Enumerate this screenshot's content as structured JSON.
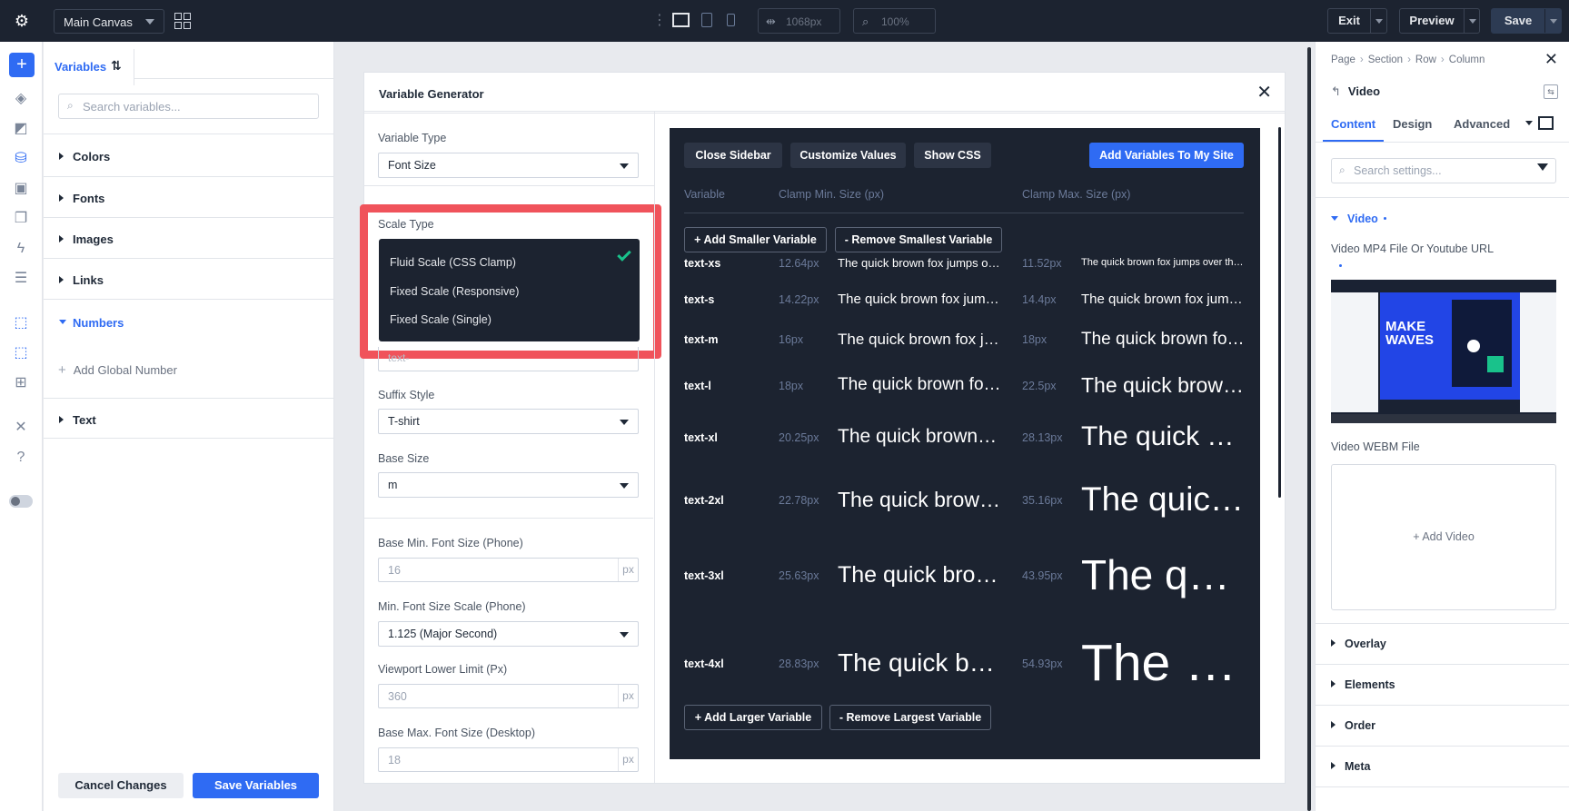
{
  "topbar": {
    "canvas_select": "Main Canvas",
    "width_value": "1068px",
    "zoom_value": "100%",
    "exit_label": "Exit",
    "preview_label": "Preview",
    "save_label": "Save"
  },
  "variables_panel": {
    "tab_label": "Variables",
    "search_placeholder": "Search variables...",
    "sections": [
      "Colors",
      "Fonts",
      "Images",
      "Links",
      "Numbers",
      "Text"
    ],
    "add_global_number": "Add Global Number",
    "cancel_label": "Cancel Changes",
    "save_label": "Save Variables"
  },
  "generator": {
    "title": "Variable Generator",
    "variable_type_label": "Variable Type",
    "variable_type_value": "Font Size",
    "scale_type_label": "Scale Type",
    "scale_options": [
      "Fluid Scale (CSS Clamp)",
      "Fixed Scale (Responsive)",
      "Fixed Scale (Single)"
    ],
    "prefix_placeholder": "text-",
    "suffix_style_label": "Suffix Style",
    "suffix_style_value": "T-shirt",
    "base_size_label": "Base Size",
    "base_size_value": "m",
    "base_min_label": "Base Min. Font Size (Phone)",
    "base_min_value": "16",
    "min_scale_label": "Min. Font Size Scale (Phone)",
    "min_scale_value": "1.125 (Major Second)",
    "viewport_lower_label": "Viewport Lower Limit (Px)",
    "viewport_lower_value": "360",
    "base_max_label": "Base Max. Font Size (Desktop)",
    "base_max_value": "18",
    "unit": "px",
    "accent_color": "#2f6bf3",
    "highlight_color": "#f0535b"
  },
  "preview": {
    "close_sidebar": "Close Sidebar",
    "customize_values": "Customize Values",
    "show_css": "Show CSS",
    "add_variables": "Add Variables To My Site",
    "col_variable": "Variable",
    "col_min": "Clamp Min. Size (px)",
    "col_max": "Clamp Max. Size (px)",
    "add_smaller": "+ Add Smaller Variable",
    "remove_smallest": "- Remove Smallest Variable",
    "add_larger": "+ Add Larger Variable",
    "remove_largest": "- Remove Largest Variable",
    "sample_text": "The quick brown fox jumps over the lazy dog",
    "rows": [
      {
        "name": "text-xs",
        "min": "12.64px",
        "max": "11.52px"
      },
      {
        "name": "text-s",
        "min": "14.22px",
        "max": "14.4px"
      },
      {
        "name": "text-m",
        "min": "16px",
        "max": "18px"
      },
      {
        "name": "text-l",
        "min": "18px",
        "max": "22.5px"
      },
      {
        "name": "text-xl",
        "min": "20.25px",
        "max": "28.13px"
      },
      {
        "name": "text-2xl",
        "min": "22.78px",
        "max": "35.16px"
      },
      {
        "name": "text-3xl",
        "min": "25.63px",
        "max": "43.95px"
      },
      {
        "name": "text-4xl",
        "min": "28.83px",
        "max": "54.93px"
      }
    ]
  },
  "settings_panel": {
    "breadcrumb": [
      "Page",
      "Section",
      "Row",
      "Column"
    ],
    "element_title": "Video",
    "tabs": [
      "Content",
      "Design",
      "Advanced"
    ],
    "search_placeholder": "Search settings...",
    "video_section": "Video",
    "mp4_label": "Video MP4 File Or Youtube URL",
    "thumb_text": "MAKE WAVES",
    "webm_label": "Video WEBM File",
    "add_video": "Add Video",
    "collapsed_sections": [
      "Overlay",
      "Elements",
      "Order",
      "Meta"
    ]
  }
}
